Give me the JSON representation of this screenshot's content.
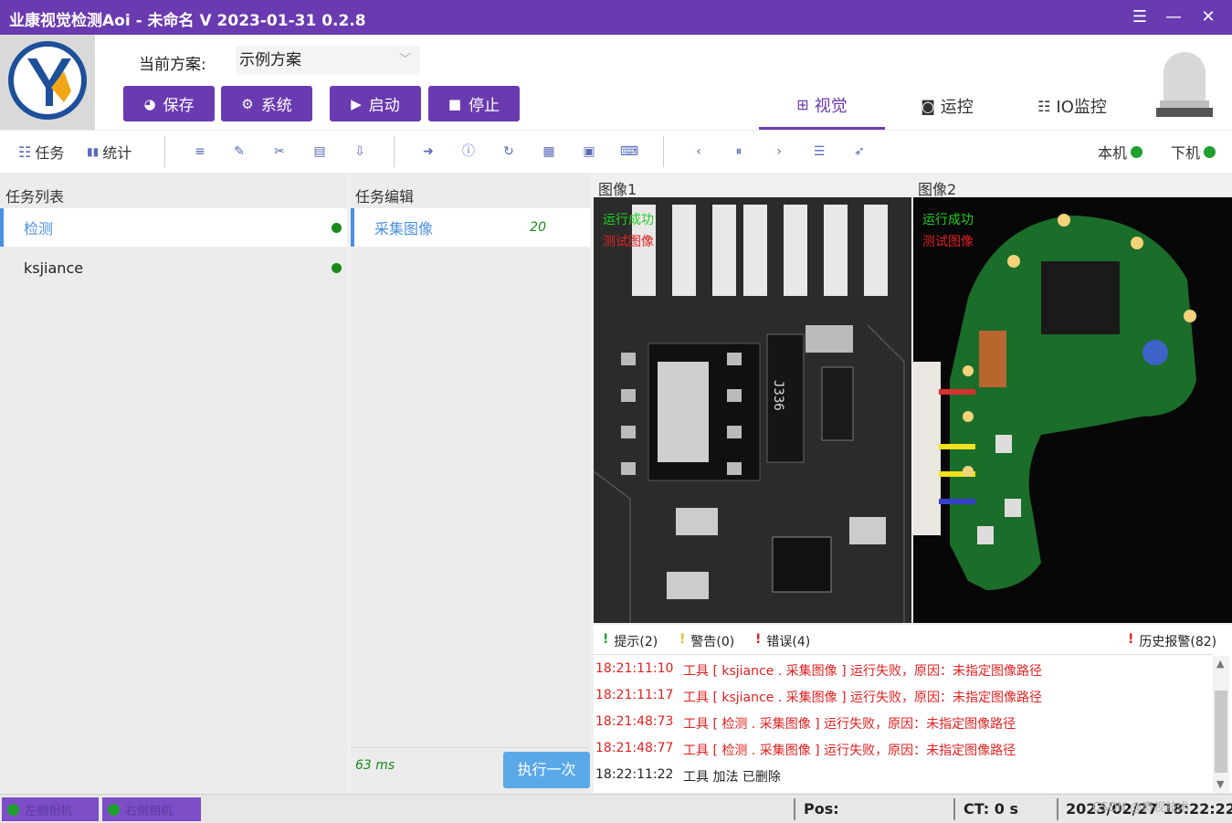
{
  "titlebar": {
    "title": "业康视觉检测Aoi - 未命名  V 2023-01-31 0.2.8",
    "menu_icon": "hamburger-icon",
    "min_icon": "minimize-icon",
    "close_icon": "close-icon"
  },
  "header": {
    "scheme_label": "当前方案:",
    "scheme_value": "示例方案",
    "buttons": {
      "save": "保存",
      "system": "系统",
      "start": "启动",
      "stop": "停止"
    },
    "nav_tabs": {
      "vision": "视觉",
      "motion": "运控",
      "io": "IO监控"
    }
  },
  "toolbar": {
    "task_label": "任务",
    "stats_label": "统计",
    "local_label": "本机",
    "remote_label": "下机"
  },
  "task_list": {
    "header": "任务列表",
    "items": [
      "检测",
      "ksjiance"
    ]
  },
  "task_edit": {
    "header": "任务编辑",
    "item_label": "采集图像",
    "item_value": "20",
    "time": "63 ms",
    "run_button": "执行一次"
  },
  "images": {
    "image1_title": "图像1",
    "image2_title": "图像2",
    "ok_text": "运行成功",
    "test_text": "测试图像",
    "chip_text": "J336"
  },
  "log": {
    "tabs": {
      "hint": "提示(2)",
      "warn": "警告(0)",
      "error": "错误(4)",
      "history": "历史报警(82)"
    },
    "lines": [
      {
        "time": "18:21:11:10",
        "msg": "工具 [ ksjiance . 采集图像 ] 运行失败，原因：未指定图像路径"
      },
      {
        "time": "18:21:11:17",
        "msg": "工具 [ ksjiance . 采集图像 ] 运行失败，原因：未指定图像路径"
      },
      {
        "time": "18:21:48:73",
        "msg": "工具 [ 检测 . 采集图像 ] 运行失败，原因：未指定图像路径"
      },
      {
        "time": "18:21:48:77",
        "msg": "工具 [ 检测 . 采集图像 ] 运行失败，原因：未指定图像路径"
      },
      {
        "time": "18:22:11:22",
        "msg": "工具 加法 已删除"
      }
    ]
  },
  "statusbar": {
    "cam1": "左侧相机",
    "cam2": "右侧相机",
    "pos_label": "Pos:",
    "ct_label": "CT:  0 s",
    "datetime": "2023/02/27 18:22:22",
    "watermark": "CSDN @奇视技术"
  },
  "colors": {
    "brand": "#6a3ab0",
    "ok": "#1fa02e",
    "error": "#e02020",
    "select": "#4a90e2"
  }
}
